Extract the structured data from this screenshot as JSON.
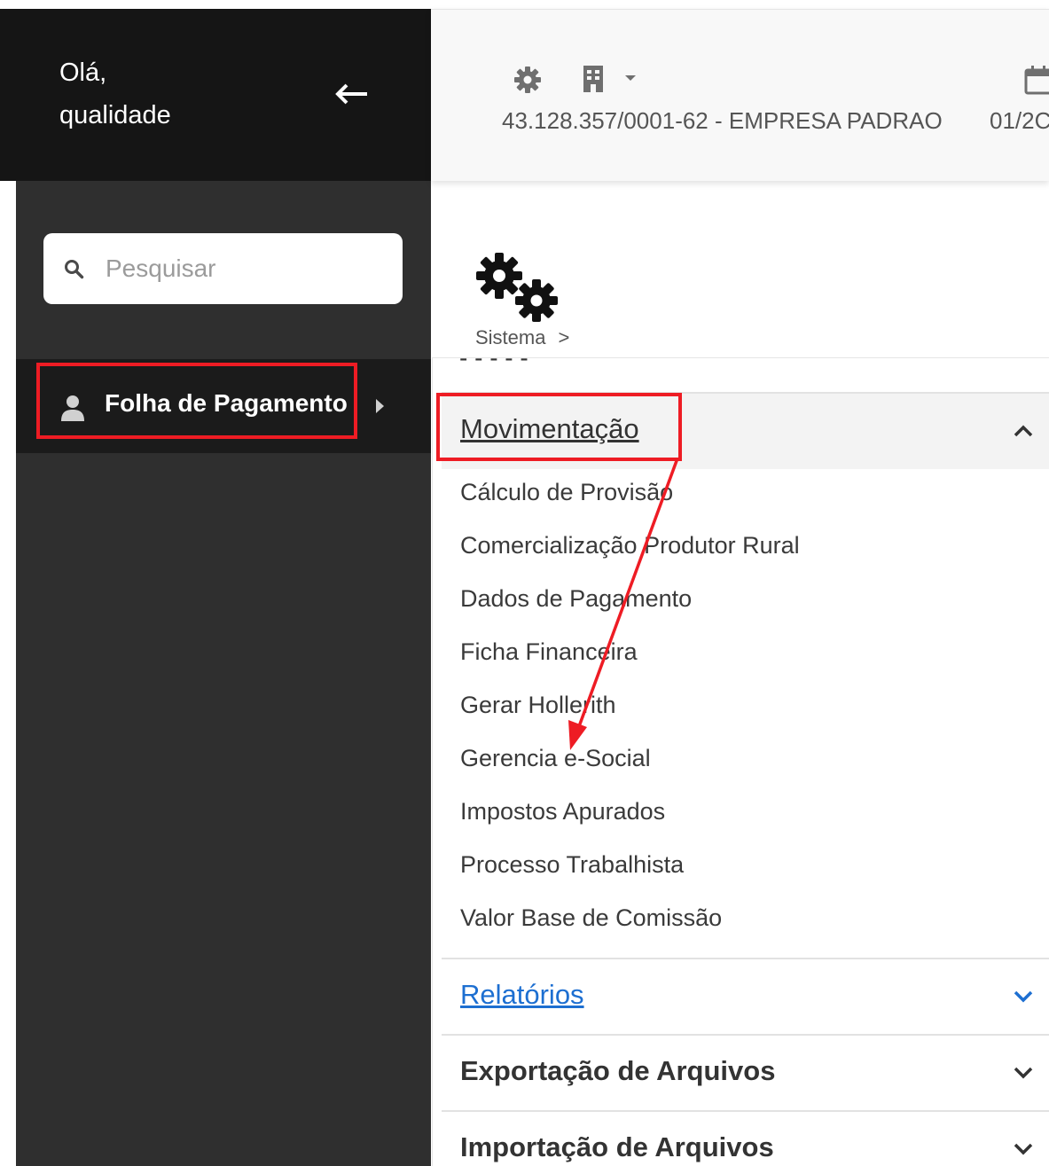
{
  "sidebar": {
    "greeting_line1": "Olá,",
    "greeting_line2": "qualidade",
    "search": {
      "placeholder": "Pesquisar"
    },
    "items": [
      {
        "label": "Folha de Pagamento",
        "icon": "user-icon"
      }
    ]
  },
  "header": {
    "company": "43.128.357/0001-62 - EMPRESA PADRAO",
    "period": "01/2C",
    "icons": [
      "gear-icon",
      "building-icon",
      "chevron-down-icon",
      "calendar-icon"
    ]
  },
  "main": {
    "breadcrumb": {
      "label": "Sistema",
      "separator": ">"
    },
    "cut_off_text": "- - - - -",
    "sections": [
      {
        "title": "Movimentação",
        "expanded": true,
        "items": [
          "Cálculo de Provisão",
          "Comercialização Produtor Rural",
          "Dados de Pagamento",
          "Ficha Financeira",
          "Gerar Hollerith",
          "Gerencia e-Social",
          "Impostos Apurados",
          "Processo Trabalhista",
          "Valor Base de Comissão"
        ]
      },
      {
        "title": "Relatórios",
        "expanded": false
      },
      {
        "title": "Exportação de Arquivos",
        "expanded": false
      },
      {
        "title": "Importação de Arquivos",
        "expanded": false
      }
    ]
  },
  "colors": {
    "sidebar_header": "#151515",
    "sidebar_body": "#2f2f2f",
    "annotation_red": "#ee1c24",
    "link_blue": "#1d6fd1"
  }
}
